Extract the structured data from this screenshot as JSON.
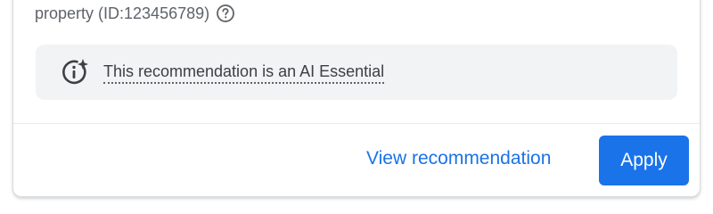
{
  "property": {
    "text": "property (ID:123456789)",
    "help_icon": "help-circle-icon"
  },
  "ai_notice": {
    "icon": "ai-sparkle-info-icon",
    "text": "This recommendation is an AI Essential"
  },
  "actions": {
    "view_label": "View recommendation",
    "apply_label": "Apply"
  },
  "colors": {
    "accent": "#1a73e8",
    "notice_background": "#f1f3f4",
    "secondary_text": "#5f6368",
    "primary_text": "#3c4043"
  }
}
